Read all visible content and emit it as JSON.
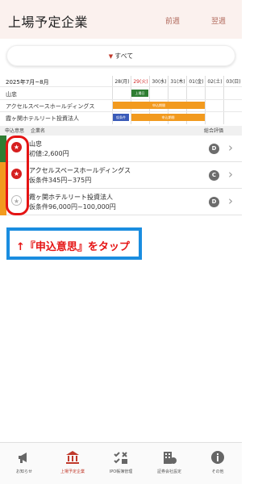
{
  "header": {
    "title": "上場予定企業",
    "prev_label": "前週",
    "next_label": "翌週"
  },
  "filter": {
    "label": "すべて"
  },
  "schedule": {
    "period": "2025年7月~8月",
    "days": [
      {
        "label": "28(月)",
        "red": false
      },
      {
        "label": "29(火)",
        "red": true
      },
      {
        "label": "30(水)",
        "red": false
      },
      {
        "label": "31(木)",
        "red": false
      },
      {
        "label": "01(金)",
        "red": false
      },
      {
        "label": "02(土)",
        "red": false
      },
      {
        "label": "03(日)",
        "red": false
      }
    ],
    "rows": [
      {
        "name": "山忠",
        "bars": [
          {
            "label": "上場日",
            "color": "green"
          }
        ]
      },
      {
        "name": "アクセルスペースホールディングス",
        "bars": [
          {
            "label": "申込期間",
            "color": "orange"
          }
        ]
      },
      {
        "name": "霞ヶ関ホテルリート投資法人",
        "bars": [
          {
            "label": "仮条件",
            "color": "blue"
          },
          {
            "label": "申込期間",
            "color": "orange"
          }
        ]
      }
    ]
  },
  "list_header": {
    "apply": "申込意思",
    "company": "企業名",
    "rating": "総合評価"
  },
  "companies": [
    {
      "name": "山忠",
      "price": "初値:2,600円",
      "grade": "D",
      "applied": true,
      "bar_color": "#2e7d32"
    },
    {
      "name": "アクセルスペースホールディングス",
      "price": "仮条件345円~375円",
      "grade": "C",
      "applied": true,
      "bar_color": "#f29a1e"
    },
    {
      "name": "霞ヶ関ホテルリート投資法人",
      "price": "仮条件96,000円~100,000円",
      "grade": "D",
      "applied": false,
      "bar_color": "#f29a1e"
    }
  ],
  "callout": {
    "text": "↑『申込意思』をタップ"
  },
  "tabs": [
    {
      "label": "お知らせ",
      "icon": "megaphone-icon",
      "active": false
    },
    {
      "label": "上場予定企業",
      "icon": "building-icon",
      "active": true
    },
    {
      "label": "IPO帳簿管理",
      "icon": "checklist-icon",
      "active": false
    },
    {
      "label": "証券会社設定",
      "icon": "bank-icon",
      "active": false
    },
    {
      "label": "その他",
      "icon": "info-icon",
      "active": false
    }
  ],
  "colors": {
    "accent": "#c0392b",
    "highlight": "#e51414",
    "callout_border": "#1a8de0",
    "header_bg": "#fbf1ee"
  }
}
